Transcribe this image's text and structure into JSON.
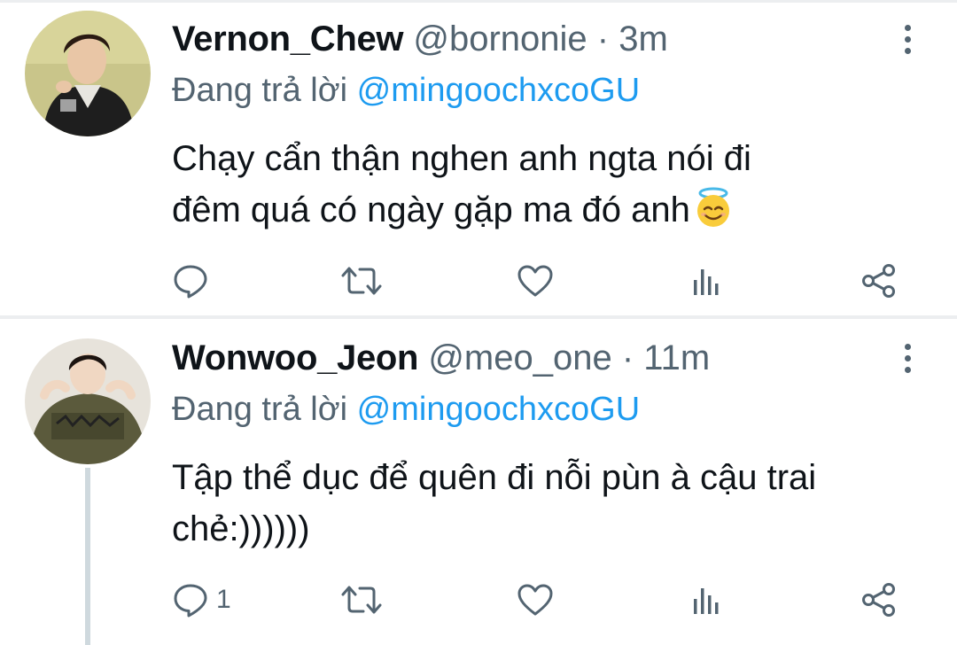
{
  "tweets": [
    {
      "name": "Vernon_Chew",
      "handle": "@bornonie",
      "separator": "·",
      "time": "3m",
      "replying_prefix": "Đang trả lời",
      "replying_to": "@mingoochxcoGU",
      "text_line1": "Chạy cẩn thận nghen anh ngta nói đi",
      "text_line2": "đêm quá có ngày gặp ma đó anh",
      "emoji": "smiling-face-with-halo",
      "reply_count": "",
      "actions": [
        "reply-icon",
        "retweet-icon",
        "like-icon",
        "views-icon",
        "share-icon"
      ]
    },
    {
      "name": "Wonwoo_Jeon",
      "handle": "@meo_one",
      "separator": "·",
      "time": "11m",
      "replying_prefix": "Đang trả lời",
      "replying_to": "@mingoochxcoGU",
      "text_line1": "Tập thể dục để quên đi nỗi pùn à cậu trai",
      "text_line2": "chẻ:))))))",
      "reply_count": "1",
      "actions": [
        "reply-icon",
        "retweet-icon",
        "like-icon",
        "views-icon",
        "share-icon"
      ]
    }
  ],
  "colors": {
    "accent": "#1d9bf0",
    "secondary_text": "#536471",
    "primary_text": "#0f1419",
    "divider": "#eceef0"
  }
}
